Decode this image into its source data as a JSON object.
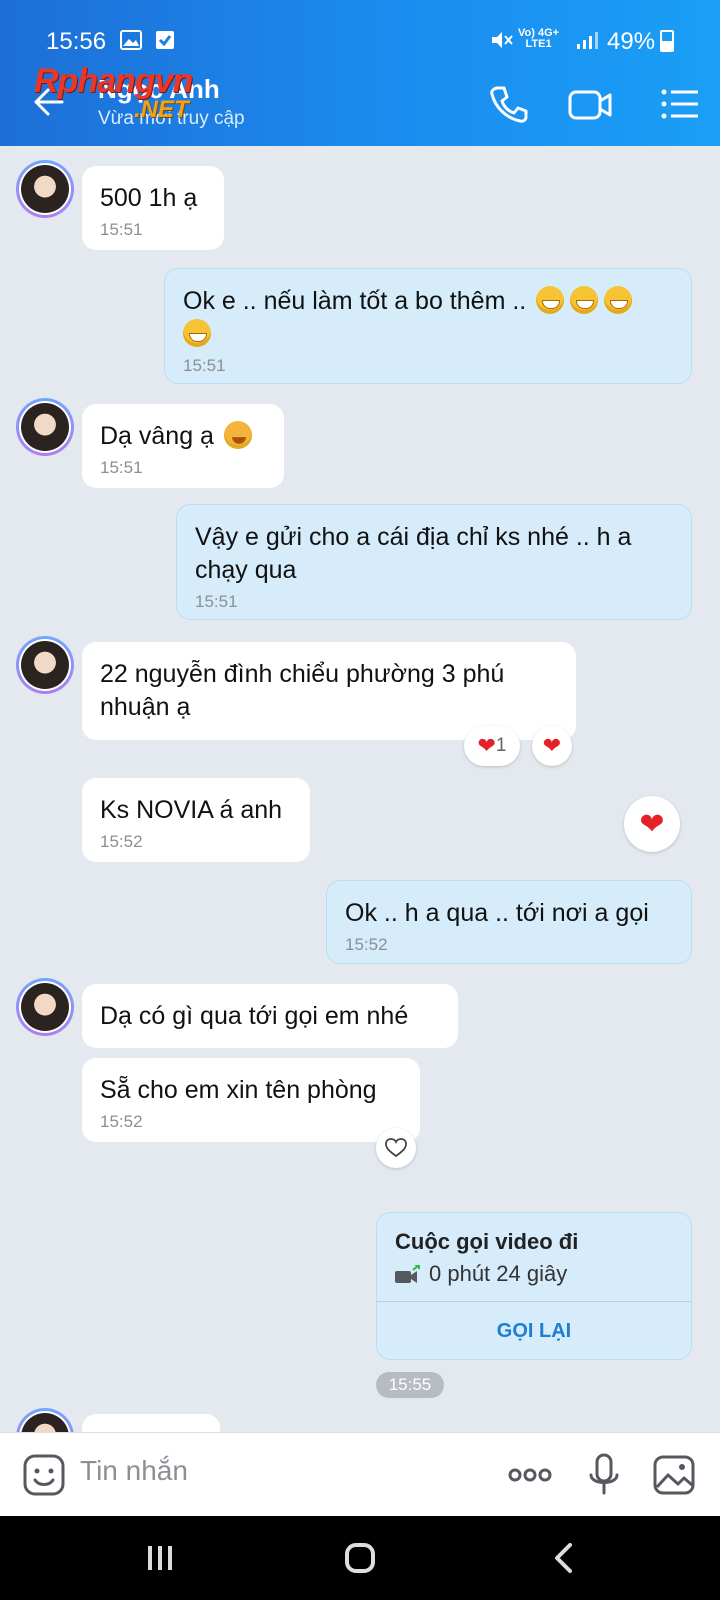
{
  "status_bar": {
    "time": "15:56",
    "network_top": "Vo) 4G+",
    "network_bottom": "LTE1",
    "battery": "49%"
  },
  "header": {
    "contact_name": "Ngọc Anh",
    "contact_status": "Vừa mới truy cập",
    "watermark_main": "Rphangvn",
    "watermark_sub": ".NET",
    "icons": [
      "back-arrow-icon",
      "phone-icon",
      "video-call-icon",
      "menu-list-icon"
    ]
  },
  "messages": [
    {
      "dir": "in",
      "text": "500 1h ạ",
      "time": "15:51"
    },
    {
      "dir": "out",
      "text": "Ok e .. nếu làm tốt a bo thêm ..",
      "time": "15:51"
    },
    {
      "dir": "in",
      "text": " Dạ vâng ạ",
      "time": "15:51"
    },
    {
      "dir": "out",
      "text": "Vậy e gửi cho a cái địa chỉ ks nhé .. h a chạy qua",
      "time": "15:51"
    },
    {
      "dir": "in",
      "text": "  22 nguyễn đình chiểu phường 3 phú nhuận ạ",
      "reaction_count": "1"
    },
    {
      "dir": "in",
      "text": "Ks NOVIA á anh",
      "time": "15:52"
    },
    {
      "dir": "out",
      "text": "Ok .. h a qua .. tới nơi a gọi",
      "time": "15:52"
    },
    {
      "dir": "in",
      "text": " Dạ có gì qua tới gọi em nhé"
    },
    {
      "dir": "in",
      "text": "Sẵ cho em xin tên phòng",
      "time": "15:52"
    }
  ],
  "call_card": {
    "title": "Cuộc gọi video đi",
    "duration": "0 phút 24 giây",
    "recall_label": "GỌI LẠI",
    "timestamp": "15:55"
  },
  "input": {
    "placeholder": "Tin nhắn"
  },
  "colors": {
    "header_blue": "#1b8cef",
    "out_bubble": "#d6ecfb",
    "heart": "#e32227",
    "recall_blue": "#1d7fd3"
  }
}
